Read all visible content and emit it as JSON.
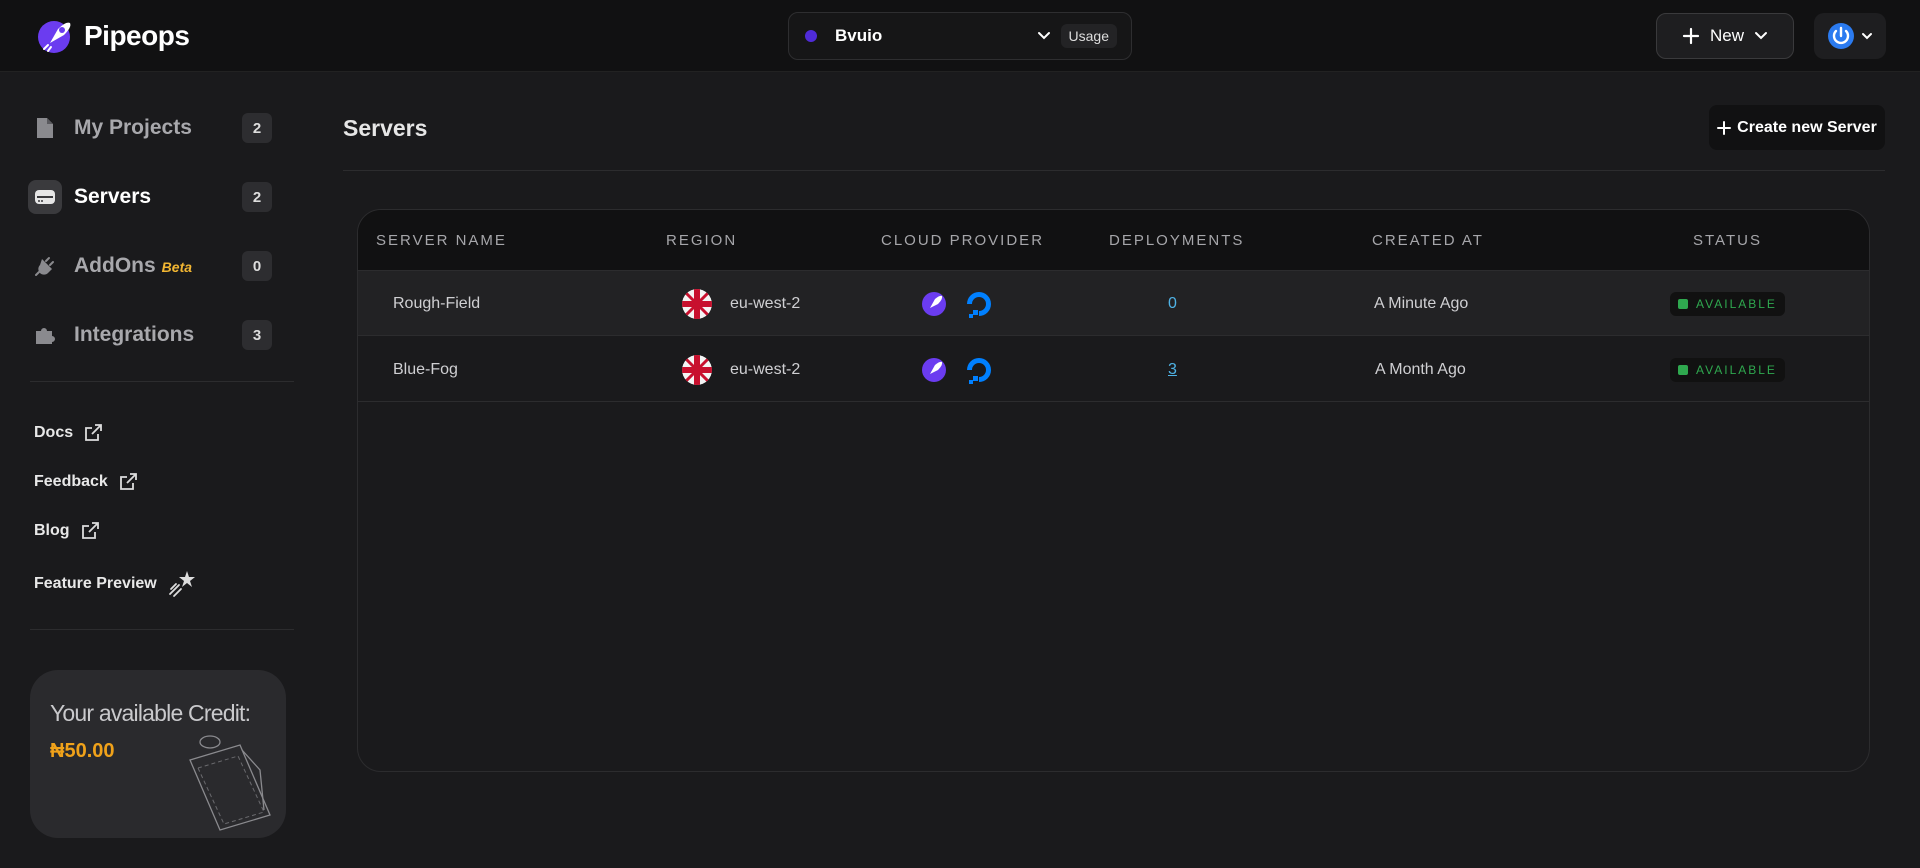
{
  "brand": {
    "name": "Pipeops"
  },
  "workspace": {
    "name": "Bvuio",
    "usage_label": "Usage"
  },
  "header": {
    "new_label": "New"
  },
  "sidebar": {
    "items": [
      {
        "label": "My Projects",
        "count": "2"
      },
      {
        "label": "Servers",
        "count": "2"
      },
      {
        "label": "AddOns",
        "badge": "Beta",
        "count": "0"
      },
      {
        "label": "Integrations",
        "count": "3"
      }
    ],
    "links": [
      {
        "label": "Docs"
      },
      {
        "label": "Feedback"
      },
      {
        "label": "Blog"
      },
      {
        "label": "Feature Preview"
      }
    ],
    "credit": {
      "title": "Your available Credit:",
      "value": "₦50.00"
    }
  },
  "main": {
    "title": "Servers",
    "create_label": "Create new Server",
    "table": {
      "headers": [
        "SERVER NAME",
        "REGION",
        "CLOUD PROVIDER",
        "DEPLOYMENTS",
        "CREATED AT",
        "STATUS"
      ],
      "rows": [
        {
          "name": "Rough-Field",
          "region": "eu-west-2",
          "deployments": "0",
          "created": "A Minute Ago",
          "status": "AVAILABLE"
        },
        {
          "name": "Blue-Fog",
          "region": "eu-west-2",
          "deployments": "3",
          "created": "A Month Ago",
          "status": "AVAILABLE"
        }
      ]
    }
  },
  "colors": {
    "accent": "#4f2bd8",
    "credit": "#f0a21a",
    "status_ok": "#2fa84f",
    "link": "#4fb3e6"
  }
}
